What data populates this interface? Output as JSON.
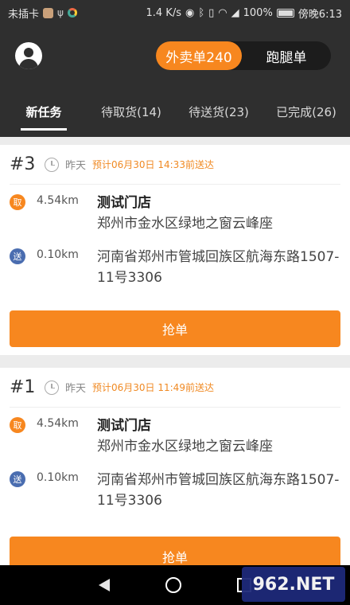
{
  "statusbar": {
    "carrier": "未插卡",
    "net_speed": "1.4 K/s",
    "battery": "100%",
    "time": "傍晚6:13"
  },
  "topbar": {
    "segments": [
      {
        "label": "外卖单240",
        "active": true
      },
      {
        "label": "跑腿单",
        "active": false
      }
    ]
  },
  "tabs": [
    {
      "label": "新任务",
      "active": true
    },
    {
      "label": "待取货(14)",
      "active": false
    },
    {
      "label": "待送货(23)",
      "active": false
    },
    {
      "label": "已完成(26)",
      "active": false
    }
  ],
  "orders": [
    {
      "number": "#3",
      "when": "昨天",
      "eta": "预计06月30日 14:33前送达",
      "pickup": {
        "badge": "取",
        "distance": "4.54km",
        "store": "测试门店",
        "address": "郑州市金水区绿地之窗云峰座"
      },
      "dropoff": {
        "badge": "送",
        "distance": "0.10km",
        "address": "河南省郑州市管城回族区航海东路1507-11号3306"
      },
      "button": "抢单"
    },
    {
      "number": "#1",
      "when": "昨天",
      "eta": "预计06月30日 11:49前送达",
      "pickup": {
        "badge": "取",
        "distance": "4.54km",
        "store": "测试门店",
        "address": "郑州市金水区绿地之窗云峰座"
      },
      "dropoff": {
        "badge": "送",
        "distance": "0.10km",
        "address": "河南省郑州市管城回族区航海东路1507-11号3306"
      },
      "button": "抢单"
    }
  ],
  "watermark": "962.NET"
}
